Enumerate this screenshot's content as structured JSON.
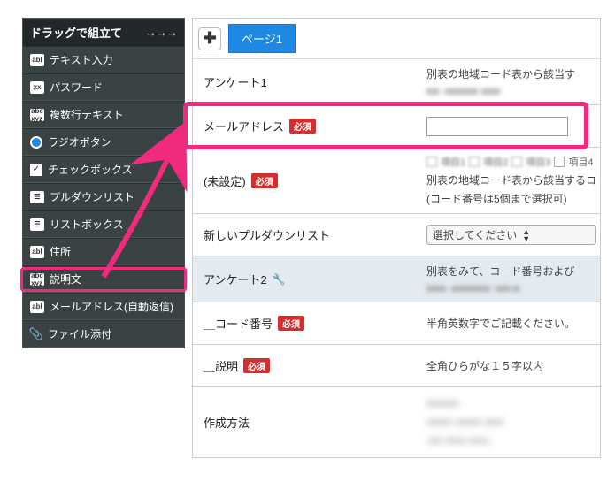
{
  "sidebar": {
    "header": "ドラッグで組立て",
    "arrows": "→→→",
    "items": [
      {
        "icon": "abl",
        "label": "テキスト入力"
      },
      {
        "icon": "xx",
        "label": "パスワード"
      },
      {
        "icon": "abc",
        "label": "複数行テキスト"
      },
      {
        "icon": "radio",
        "label": "ラジオボタン"
      },
      {
        "icon": "check",
        "label": "チェックボックス"
      },
      {
        "icon": "list",
        "label": "プルダウンリスト"
      },
      {
        "icon": "list",
        "label": "リストボックス"
      },
      {
        "icon": "abl",
        "label": "住所"
      },
      {
        "icon": "abc",
        "label": "説明文"
      },
      {
        "icon": "abl",
        "label": "メールアドレス(自動返信)"
      },
      {
        "icon": "clip",
        "label": "ファイル添付"
      }
    ]
  },
  "main": {
    "tab_page1": "ページ1",
    "rows": {
      "survey1": {
        "label": "アンケート1",
        "desc": "別表の地域コード表から該当す",
        "blur": "■■ ▪︎■■■■■ ■■■"
      },
      "email": {
        "label": "メールアドレス",
        "required": "必須"
      },
      "unset": {
        "label": "(未設定)",
        "required": "必須",
        "checkboxes": [
          "項目1",
          "項目2",
          "項目3",
          "項目4"
        ],
        "desc": "別表の地域コード表から該当するコ",
        "desc2": "(コード番号は5個まで選択可)"
      },
      "pulldown": {
        "label": "新しいプルダウンリスト",
        "value": "選択してください"
      },
      "survey2": {
        "label": "アンケート2",
        "desc": "別表をみて、コード番号および",
        "blur": "■■■–■■■■■■ ▪︎■■▪︎■"
      },
      "code": {
        "label": "＿コード番号",
        "required": "必須",
        "desc": "半角英数字でご記載ください。"
      },
      "explain": {
        "label": "＿説明",
        "required": "必須",
        "desc": "全角ひらがな１５字以内"
      },
      "method": {
        "label": "作成方法",
        "blur1": "■■■■■.",
        "blur2": "■■■■-■■■■ ■■■",
        "blur3": "(■■ ■■■ ■■■)"
      }
    }
  }
}
